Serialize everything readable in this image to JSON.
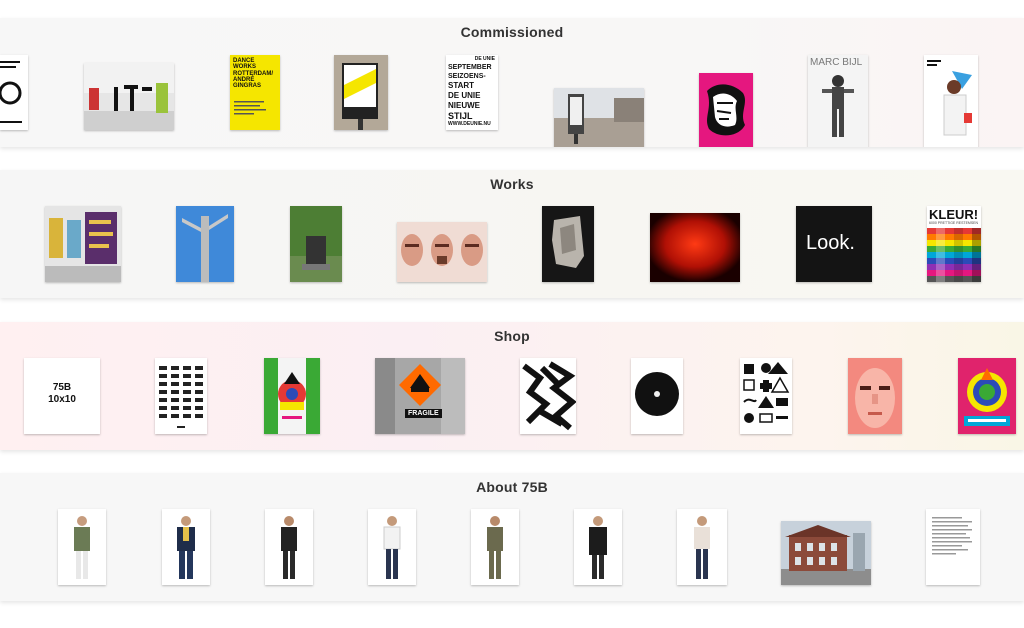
{
  "sections": {
    "commissioned": {
      "title": "Commissioned"
    },
    "works": {
      "title": "Works"
    },
    "shop": {
      "title": "Shop"
    },
    "about": {
      "title": "About 75B"
    }
  },
  "thumbnails": {
    "dance_works": "DANCE WORKS ROTTERDAM/ ANDRÉ GINGRAS",
    "deunie_top": "DE UNIE",
    "deunie_lines": [
      "SEPTEMBER",
      "SEIZOENS-",
      "START",
      "DE UNIE",
      "NIEUWE",
      "STIJL"
    ],
    "deunie_url": "WWW.DEUNIE.NU",
    "marc_bijl": "MARC BIJL",
    "look": "Look.",
    "kleur": "KLEUR!",
    "kleur_sub": "6000 PRETTIGE RESTEMSEN",
    "book_75b_line1": "75B",
    "book_75b_line2": "10x10",
    "fragile": "FRAGILE"
  },
  "colors": {
    "accent_yellow": "#f5e600",
    "accent_magenta": "#e5177f",
    "accent_orange": "#ff6a00",
    "accent_green": "#3aa935"
  }
}
